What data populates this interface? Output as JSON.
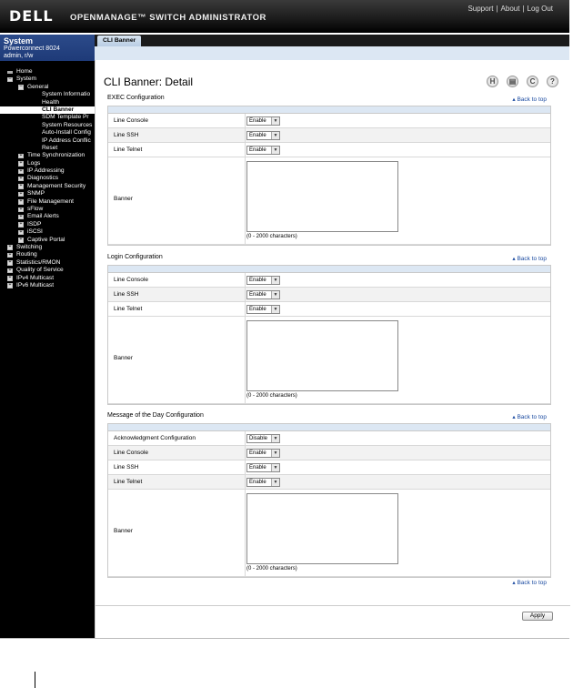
{
  "header": {
    "logo": "DELL",
    "app_title": "OPENMANAGE™ SWITCH ADMINISTRATOR",
    "links": [
      "Support",
      "About",
      "Log Out"
    ]
  },
  "sidebar": {
    "system_title": "System",
    "system_model": "Powerconnect 8024",
    "user": "admin, r/w",
    "items": [
      {
        "label": "Home",
        "level": 0,
        "icon": "home"
      },
      {
        "label": "System",
        "level": 0,
        "icon": "minus"
      },
      {
        "label": "General",
        "level": 1,
        "icon": "minus"
      },
      {
        "label": "System Informatio",
        "level": 2,
        "icon": ""
      },
      {
        "label": "Health",
        "level": 2,
        "icon": ""
      },
      {
        "label": "CLI Banner",
        "level": 2,
        "icon": "",
        "active": true
      },
      {
        "label": "SDM Template Pr",
        "level": 2,
        "icon": ""
      },
      {
        "label": "System Resources",
        "level": 2,
        "icon": ""
      },
      {
        "label": "Auto-Install Config",
        "level": 2,
        "icon": ""
      },
      {
        "label": "IP Address Conflic",
        "level": 2,
        "icon": ""
      },
      {
        "label": "Reset",
        "level": 2,
        "icon": ""
      },
      {
        "label": "Time Synchronization",
        "level": 1,
        "icon": "plus"
      },
      {
        "label": "Logs",
        "level": 1,
        "icon": "plus"
      },
      {
        "label": "IP Addressing",
        "level": 1,
        "icon": "plus"
      },
      {
        "label": "Diagnostics",
        "level": 1,
        "icon": "plus"
      },
      {
        "label": "Management Security",
        "level": 1,
        "icon": "plus"
      },
      {
        "label": "SNMP",
        "level": 1,
        "icon": "plus"
      },
      {
        "label": "File Management",
        "level": 1,
        "icon": "plus"
      },
      {
        "label": "sFlow",
        "level": 1,
        "icon": "plus"
      },
      {
        "label": "Email Alerts",
        "level": 1,
        "icon": "plus"
      },
      {
        "label": "ISDP",
        "level": 1,
        "icon": "plus"
      },
      {
        "label": "iSCSI",
        "level": 1,
        "icon": "plus"
      },
      {
        "label": "Captive Portal",
        "level": 1,
        "icon": "plus"
      },
      {
        "label": "Switching",
        "level": 0,
        "icon": "plus"
      },
      {
        "label": "Routing",
        "level": 0,
        "icon": "plus"
      },
      {
        "label": "Statistics/RMON",
        "level": 0,
        "icon": "plus"
      },
      {
        "label": "Quality of Service",
        "level": 0,
        "icon": "plus"
      },
      {
        "label": "IPv4 Multicast",
        "level": 0,
        "icon": "plus"
      },
      {
        "label": "IPv6 Multicast",
        "level": 0,
        "icon": "plus"
      }
    ]
  },
  "tab": {
    "label": "CLI Banner"
  },
  "main": {
    "title": "CLI Banner: Detail",
    "tool_icons": [
      "H",
      "▤",
      "C",
      "?"
    ],
    "back_to_top": "▴ Back to top",
    "apply_label": "Apply",
    "sections": [
      {
        "title": "EXEC Configuration",
        "rows": [
          {
            "label": "Line Console",
            "value": "Enable"
          },
          {
            "label": "Line SSH",
            "value": "Enable"
          },
          {
            "label": "Line Telnet",
            "value": "Enable"
          }
        ],
        "banner_label": "Banner",
        "banner_value": "",
        "hint": "(0 - 2000 characters)"
      },
      {
        "title": "Login Configuration",
        "rows": [
          {
            "label": "Line Console",
            "value": "Enable"
          },
          {
            "label": "Line SSH",
            "value": "Enable"
          },
          {
            "label": "Line Telnet",
            "value": "Enable"
          }
        ],
        "banner_label": "Banner",
        "banner_value": "",
        "hint": "(0 - 2000 characters)"
      },
      {
        "title": "Message of the Day Configuration",
        "rows": [
          {
            "label": "Acknowledgment Configuration",
            "value": "Disable"
          },
          {
            "label": "Line Console",
            "value": "Enable"
          },
          {
            "label": "Line SSH",
            "value": "Enable"
          },
          {
            "label": "Line Telnet",
            "value": "Enable"
          }
        ],
        "banner_label": "Banner",
        "banner_value": "",
        "hint": "(0 - 2000 characters)"
      }
    ]
  },
  "colors": {
    "header_bg": "#000000",
    "sidebar_bg": "#000000",
    "system_box": "#1e3a78",
    "section_head": "#dce7f3",
    "link": "#1a4aa0"
  }
}
